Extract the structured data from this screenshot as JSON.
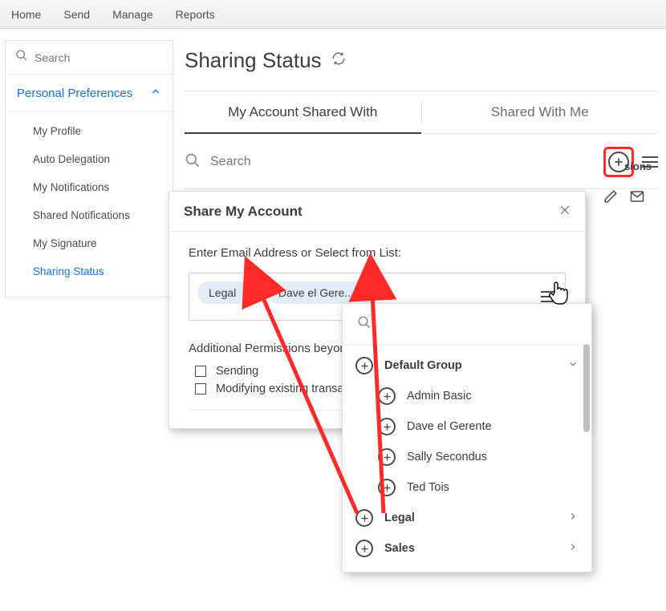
{
  "topnav": [
    "Home",
    "Send",
    "Manage",
    "Reports"
  ],
  "sidebar": {
    "search_placeholder": "Search",
    "section_title": "Personal Preferences",
    "items": [
      {
        "label": "My Profile"
      },
      {
        "label": "Auto Delegation"
      },
      {
        "label": "My Notifications"
      },
      {
        "label": "Shared Notifications"
      },
      {
        "label": "My Signature"
      },
      {
        "label": "Sharing Status",
        "active": true
      }
    ]
  },
  "main": {
    "title": "Sharing Status",
    "tabs": [
      "My Account Shared With",
      "Shared With Me"
    ],
    "active_tab": 0,
    "search_placeholder": "Search",
    "column_stub": "sions"
  },
  "dialog": {
    "title": "Share My Account",
    "field_label": "Enter Email Address or Select from List:",
    "chips": [
      "Legal",
      "Dave el Gere..."
    ],
    "perm_label": "Additional Permissions beyon",
    "checkboxes": [
      "Sending",
      "Modifying existing transacti"
    ]
  },
  "dropdown": {
    "groups": [
      {
        "name": "Default Group",
        "expanded": true,
        "items": [
          "Admin Basic",
          "Dave el Gerente",
          "Sally Secondus",
          "Ted Tois"
        ]
      },
      {
        "name": "Legal",
        "expanded": false
      },
      {
        "name": "Sales",
        "expanded": false
      }
    ]
  }
}
